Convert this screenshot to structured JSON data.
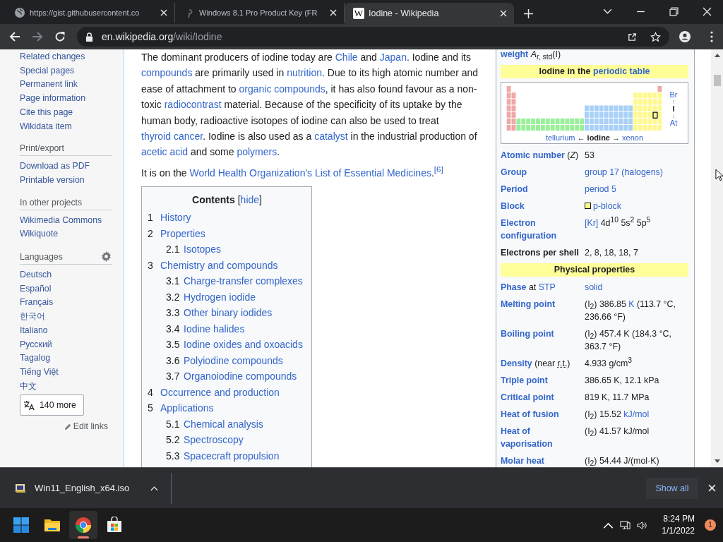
{
  "browser": {
    "tabs": [
      {
        "title": "https://gist.githubusercontent.co",
        "kind": "globe",
        "selected": false
      },
      {
        "title": "Windows 8.1 Pro Product Key (FR",
        "kind": "pin",
        "selected": false
      },
      {
        "title": "Iodine - Wikipedia",
        "kind": "letter",
        "icon_text": "W",
        "selected": true
      }
    ],
    "address": {
      "host": "en.wikipedia.org",
      "path": "/wiki/Iodine"
    },
    "forward_disabled": true
  },
  "sidebar": {
    "sections": [
      {
        "items": [
          "Related changes",
          "Special pages",
          "Permanent link",
          "Page information",
          "Cite this page",
          "Wikidata item"
        ]
      },
      {
        "heading": "Print/export",
        "items": [
          "Download as PDF",
          "Printable version"
        ]
      },
      {
        "heading": "In other projects",
        "items": [
          "Wikimedia Commons",
          "Wikiquote"
        ]
      },
      {
        "heading": "Languages",
        "settings": true,
        "items": [
          "Deutsch",
          "Español",
          "Français",
          "한국어",
          "Italiano",
          "Русский",
          "Tagalog",
          "Tiếng Việt",
          "中文"
        ]
      }
    ],
    "more_button": "140 more",
    "edit_links": "Edit links"
  },
  "article": {
    "paragraphs": [
      [
        {
          "t": "The dominant producers of iodine today are "
        },
        {
          "t": "Chile",
          "link": true
        },
        {
          "t": " and "
        },
        {
          "t": "Japan",
          "link": true
        },
        {
          "t": ". Iodine and its "
        },
        {
          "t": "compounds",
          "link": true
        },
        {
          "t": " are primarily used in "
        },
        {
          "t": "nutrition",
          "link": true
        },
        {
          "t": ". Due to its high atomic number and ease of attachment to "
        },
        {
          "t": "organic compounds",
          "link": true
        },
        {
          "t": ", it has also found favour as a non-toxic "
        },
        {
          "t": "radiocontrast",
          "link": true
        },
        {
          "t": " material. Because of the specificity of its uptake by the human body, radioactive isotopes of iodine can also be used to treat "
        },
        {
          "t": "thyroid cancer",
          "link": true
        },
        {
          "t": ". Iodine is also used as a "
        },
        {
          "t": "catalyst",
          "link": true
        },
        {
          "t": " in the industrial production of "
        },
        {
          "t": "acetic acid",
          "link": true
        },
        {
          "t": " and some "
        },
        {
          "t": "polymers",
          "link": true
        },
        {
          "t": "."
        }
      ],
      [
        {
          "t": "It is on the "
        },
        {
          "t": "World Health Organization's List of Essential Medicines",
          "link": true
        },
        {
          "t": "."
        },
        {
          "t": "$^{[6]}$",
          "link": true
        }
      ]
    ],
    "contents": {
      "title": "Contents",
      "toggle_before": "[",
      "toggle": "hide",
      "toggle_after": "]",
      "items": [
        {
          "number": "1",
          "title": "History"
        },
        {
          "number": "2",
          "title": "Properties",
          "children": [
            {
              "number": "2.1",
              "title": "Isotopes"
            }
          ]
        },
        {
          "number": "3",
          "title": "Chemistry and compounds",
          "children": [
            {
              "number": "3.1",
              "title": "Charge-transfer complexes"
            },
            {
              "number": "3.2",
              "title": "Hydrogen iodide"
            },
            {
              "number": "3.3",
              "title": "Other binary iodides"
            },
            {
              "number": "3.4",
              "title": "Iodine halides"
            },
            {
              "number": "3.5",
              "title": "Iodine oxides and oxoacids"
            },
            {
              "number": "3.6",
              "title": "Polyiodine compounds"
            },
            {
              "number": "3.7",
              "title": "Organoiodine compounds"
            }
          ]
        },
        {
          "number": "4",
          "title": "Occurrence and production"
        },
        {
          "number": "5",
          "title": "Applications",
          "children": [
            {
              "number": "5.1",
              "title": "Chemical analysis"
            },
            {
              "number": "5.2",
              "title": "Spectroscopy"
            },
            {
              "number": "5.3",
              "title": "Spacecraft propulsion"
            }
          ]
        }
      ]
    }
  },
  "infobox": {
    "rows": [
      {
        "kind": "row",
        "label": [
          {
            "t": "weight",
            "link": true,
            "bold": true
          },
          {
            "t": " *A*$_{r, std}$(I)"
          }
        ]
      },
      {
        "kind": "header",
        "runs": [
          {
            "t": "Iodine in the "
          },
          {
            "t": "periodic table",
            "link": true
          }
        ]
      },
      {
        "kind": "periodic_table",
        "caption": [
          {
            "t": "tellurium",
            "link": true
          },
          {
            "t": " ← "
          },
          {
            "t": "iodine",
            "bold": true
          },
          {
            "t": " → "
          },
          {
            "t": "xenon",
            "link": true
          }
        ],
        "side": [
          {
            "t": "Br",
            "link": true
          },
          {
            "t": "↑"
          },
          {
            "t": "I",
            "bold": true
          },
          {
            "t": "↓"
          },
          {
            "t": "At",
            "link": true
          }
        ]
      },
      {
        "kind": "row",
        "label": [
          {
            "t": "Atomic number",
            "link": true,
            "bold": true
          },
          {
            "t": " (*Z*)"
          }
        ],
        "value": [
          {
            "t": "53"
          }
        ]
      },
      {
        "kind": "row",
        "label": [
          {
            "t": "Group",
            "link": true,
            "bold": true
          }
        ],
        "value": [
          {
            "t": "group 17 (halogens)",
            "link": true
          }
        ]
      },
      {
        "kind": "row",
        "label": [
          {
            "t": "Period",
            "link": true,
            "bold": true
          }
        ],
        "value": [
          {
            "t": "period 5",
            "link": true
          }
        ]
      },
      {
        "kind": "row",
        "label": [
          {
            "t": "Block",
            "link": true,
            "bold": true
          }
        ],
        "value": [
          {
            "t": "p-block",
            "link": true,
            "swatch": true
          }
        ]
      },
      {
        "kind": "row",
        "label": [
          {
            "t": "Electron configuration",
            "link": true,
            "bold": true
          }
        ],
        "value": [
          {
            "t": "[Kr]",
            "link": true
          },
          {
            "t": " 4d$^{10}$ 5s$^{2}$ 5p$^{5}$"
          }
        ]
      },
      {
        "kind": "row",
        "label": [
          {
            "t": "Electrons per shell",
            "bold": true
          }
        ],
        "value": [
          {
            "t": "2, 8, 18, 18, 7"
          }
        ]
      },
      {
        "kind": "header",
        "runs": [
          {
            "t": "Physical properties"
          }
        ]
      },
      {
        "kind": "row",
        "label": [
          {
            "t": "Phase",
            "link": true,
            "bold": true
          },
          {
            "t": " at "
          },
          {
            "t": "STP",
            "link": true
          }
        ],
        "value": [
          {
            "t": "solid",
            "link": true
          }
        ]
      },
      {
        "kind": "row",
        "label": [
          {
            "t": "Melting point",
            "link": true,
            "bold": true
          }
        ],
        "value": [
          {
            "t": "(I$_{2}$) 386.85 "
          },
          {
            "t": "K",
            "link": true
          },
          {
            "t": " (113.7 °C, 236.66 °F)"
          }
        ]
      },
      {
        "kind": "row",
        "label": [
          {
            "t": "Boiling point",
            "link": true,
            "bold": true
          }
        ],
        "value": [
          {
            "t": "(I$_{2}$) 457.4 K (184.3 °C, 363.7 °F)"
          }
        ]
      },
      {
        "kind": "row",
        "label": [
          {
            "t": "Density",
            "link": true,
            "bold": true
          },
          {
            "t": " (near "
          },
          {
            "t": "r.t.",
            "abbr": true
          },
          {
            "t": ")"
          }
        ],
        "value": [
          {
            "t": "4.933 g/cm$^{3}$"
          }
        ]
      },
      {
        "kind": "row",
        "label": [
          {
            "t": "Triple point",
            "link": true,
            "bold": true
          }
        ],
        "value": [
          {
            "t": "386.65 K, 12.1 kPa"
          }
        ]
      },
      {
        "kind": "row",
        "label": [
          {
            "t": "Critical point",
            "link": true,
            "bold": true
          }
        ],
        "value": [
          {
            "t": "819 K, 11.7 MPa"
          }
        ]
      },
      {
        "kind": "row",
        "label": [
          {
            "t": "Heat of fusion",
            "link": true,
            "bold": true
          }
        ],
        "value": [
          {
            "t": "(I$_{2}$) 15.52 "
          },
          {
            "t": "kJ/mol",
            "link": true
          }
        ]
      },
      {
        "kind": "row",
        "label": [
          {
            "t": "Heat of vaporisation",
            "link": true,
            "bold": true
          }
        ],
        "value": [
          {
            "t": "(I$_{2}$) 41.57 kJ/mol"
          }
        ]
      },
      {
        "kind": "row",
        "label": [
          {
            "t": "Molar heat",
            "link": true,
            "bold": true
          }
        ],
        "value": [
          {
            "t": "(I$_{2}$) 54.44 J/(mol·K)"
          }
        ]
      }
    ]
  },
  "downloads": {
    "file": "Win11_English_x64.iso",
    "show_all": "Show all"
  },
  "taskbar": {
    "apps": [
      {
        "kind": "start",
        "active": false
      },
      {
        "kind": "explorer",
        "active": false
      },
      {
        "kind": "chrome",
        "active": true
      },
      {
        "kind": "store",
        "active": false
      }
    ],
    "time": "8:24 PM",
    "date": "1/1/2022",
    "notifications": "1"
  }
}
